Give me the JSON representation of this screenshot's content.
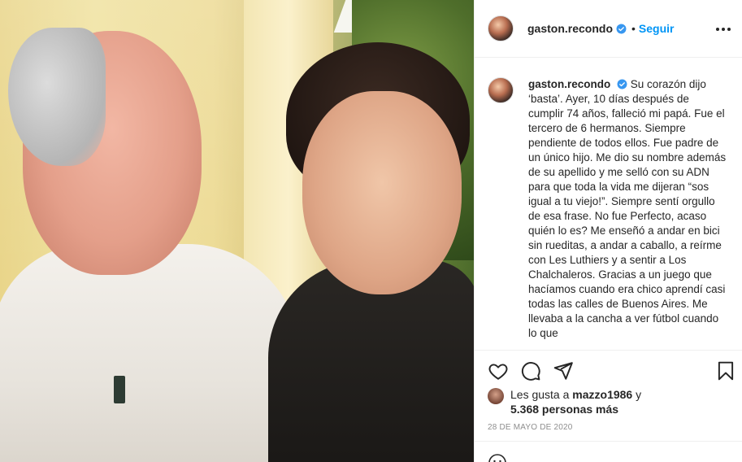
{
  "post": {
    "username": "gaston.recondo",
    "follow_label": "Seguir",
    "separator": "•",
    "caption": "Su corazón dijo ‘basta’. Ayer, 10 días después de cumplir 74 años, falleció mi papá. Fue el tercero de 6 hermanos. Siempre pendiente de todos ellos. Fue padre de un único hijo. Me dio su nombre además de su apellido y me selló con su ADN para que toda la vida me dijeran “sos igual a tu viejo!”. Siempre sentí orgullo de esa frase. No fue Perfecto, acaso quién lo es? Me enseñó a andar en bici sin rueditas, a andar a caballo, a reírme con Les Luthiers y a sentir a Los Chalchaleros. Gracias a un juego que hacíamos cuando era chico aprendí casi todas las calles de Buenos Aires. Me llevaba a la cancha a ver fútbol cuando lo que"
  },
  "likes": {
    "prefix": "Les gusta a",
    "user": "mazzo1986",
    "connector": "y",
    "others": "5.368 personas más"
  },
  "date": "28 DE MAYO DE 2020",
  "icons": {
    "verified": "verified-badge-icon",
    "more": "more-options-icon",
    "like": "heart-icon",
    "comment": "comment-bubble-icon",
    "share": "send-icon",
    "save": "bookmark-icon",
    "emoji": "emoji-icon"
  },
  "colors": {
    "link": "#0095f6",
    "text": "#262626",
    "muted": "#8e8e8e",
    "border": "#efefef"
  }
}
